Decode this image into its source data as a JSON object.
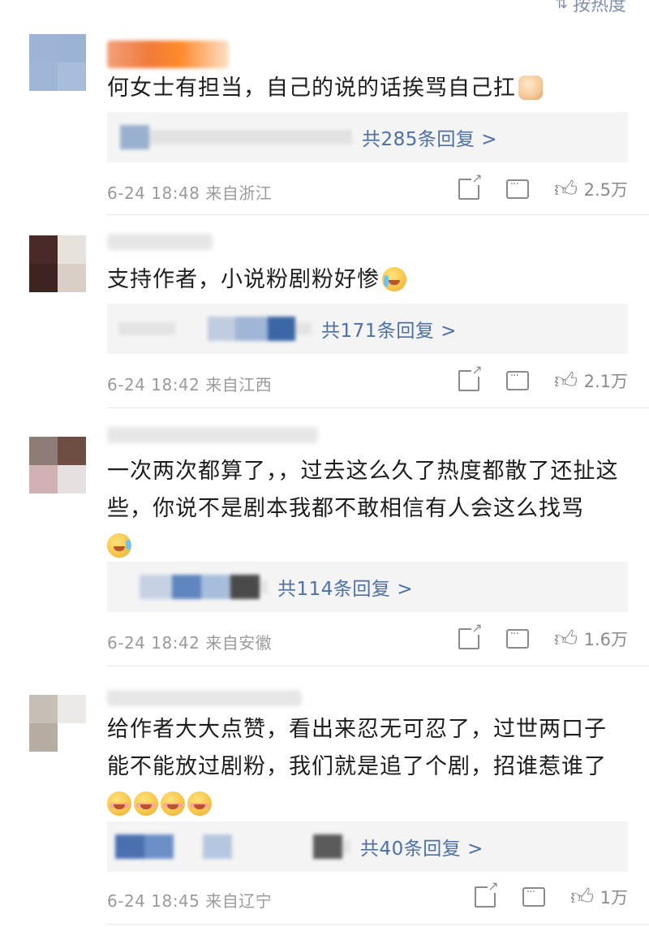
{
  "sort_label": "按热度",
  "colors": {
    "link": "#4d6fa8",
    "meta": "#9a9a9a",
    "reply_bg": "#f4f4f4"
  },
  "comments": [
    {
      "text": "何女士有担当，自己的说的话挨骂自己扛",
      "emojis": [
        "fist"
      ],
      "reply_count_label": "共285条回复 >",
      "time": "6-24 18:48",
      "location": "来自浙江",
      "likes": "2.5万"
    },
    {
      "text": "支持作者，小说粉剧粉好惨",
      "emojis": [
        "cry"
      ],
      "reply_count_label": "共171条回复 >",
      "time": "6-24 18:42",
      "location": "来自江西",
      "likes": "2.1万"
    },
    {
      "text": "一次两次都算了，，过去这么久了热度都散了还扯这些，你说不是剧本我都不敢相信有人会这么找骂",
      "emojis": [
        "laugh"
      ],
      "reply_count_label": "共114条回复 >",
      "time": "6-24 18:42",
      "location": "来自安徽",
      "likes": "1.6万"
    },
    {
      "text": "给作者大大点赞，看出来忍无可忍了，过世两口子能不能放过剧粉，我们就是追了个剧，招谁惹谁了",
      "emojis": [
        "shy",
        "shy",
        "shy",
        "shy"
      ],
      "reply_count_label": "共40条回复 >",
      "time": "6-24 18:45",
      "location": "来自辽宁",
      "likes": "1万"
    }
  ],
  "icons": [
    "sort-icon",
    "share-icon",
    "comment-icon",
    "like-icon"
  ]
}
